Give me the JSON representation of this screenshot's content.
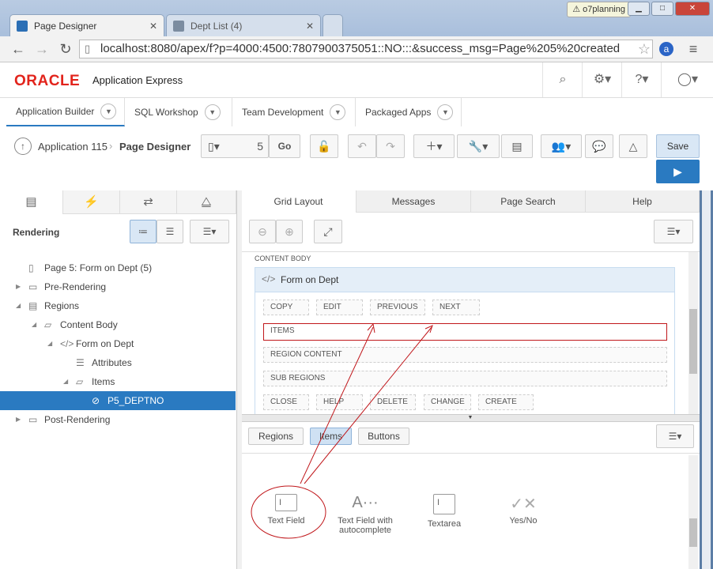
{
  "browser": {
    "tabs": [
      {
        "title": "Page Designer",
        "favicon_color": "#2c6fb5"
      },
      {
        "title": "Dept List (4)",
        "favicon_color": "#7b8ca0"
      }
    ],
    "profile_name": "o7planning",
    "url": "localhost:8080/apex/f?p=4000:4500:7807900375051::NO:::&success_msg=Page%205%20created"
  },
  "apex_header": {
    "logo": "ORACLE",
    "product": "Application Express"
  },
  "nav_tabs": [
    "Application Builder",
    "SQL Workshop",
    "Team Development",
    "Packaged Apps"
  ],
  "toolbar": {
    "app_link": "Application 115",
    "current": "Page Designer",
    "page_number": "5",
    "go_label": "Go",
    "save_label": "Save"
  },
  "left_pane": {
    "heading": "Rendering",
    "tree": [
      {
        "label": "Page 5: Form on Dept (5)",
        "level": 0,
        "icon": "page-icon"
      },
      {
        "label": "Pre-Rendering",
        "level": 0,
        "icon": "folder-icon",
        "tri": "right"
      },
      {
        "label": "Regions",
        "level": 0,
        "icon": "region-icon",
        "tri": "down"
      },
      {
        "label": "Content Body",
        "level": 1,
        "icon": "folder-open-icon",
        "tri": "down"
      },
      {
        "label": "Form on Dept",
        "level": 2,
        "icon": "code-icon",
        "tri": "down"
      },
      {
        "label": "Attributes",
        "level": 3,
        "icon": "list-icon"
      },
      {
        "label": "Items",
        "level": 3,
        "icon": "folder-open-icon",
        "tri": "down"
      },
      {
        "label": "P5_DEPTNO",
        "level": 4,
        "icon": "hidden-eye-icon",
        "selected": true
      },
      {
        "label": "Post-Rendering",
        "level": 0,
        "icon": "folder-icon",
        "tri": "right"
      }
    ]
  },
  "right_pane": {
    "tabs": [
      "Grid Layout",
      "Messages",
      "Page Search",
      "Help"
    ],
    "section_label": "CONTENT BODY",
    "region_title": "Form on Dept",
    "chips_top": [
      "COPY",
      "EDIT",
      "PREVIOUS",
      "NEXT"
    ],
    "items_row": "ITEMS",
    "region_content": "REGION CONTENT",
    "sub_regions": "SUB REGIONS",
    "chips_bottom": [
      "CLOSE",
      "HELP",
      "DELETE",
      "CHANGE",
      "CREATE"
    ],
    "gallery_tabs": [
      "Regions",
      "Items",
      "Buttons"
    ],
    "gallery_items": [
      {
        "label": "Text Field"
      },
      {
        "label": "Text Field with autocomplete"
      },
      {
        "label": "Textarea"
      },
      {
        "label": "Yes/No"
      }
    ]
  },
  "colors": {
    "selected_blue": "#2a7ac1",
    "annotation_red": "#c0171b",
    "oracle_red": "#e2241c"
  }
}
